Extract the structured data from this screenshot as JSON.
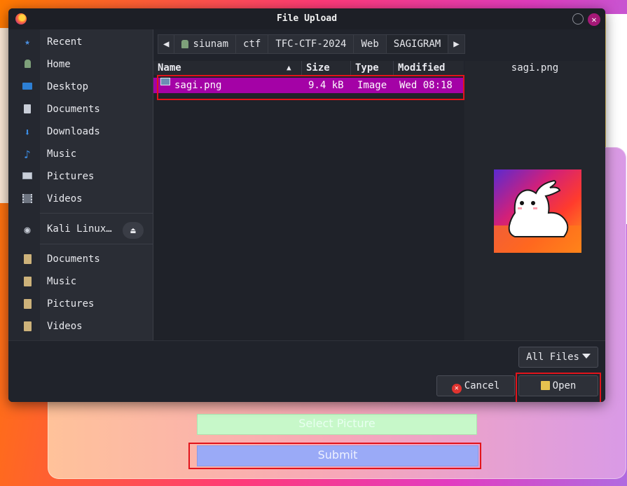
{
  "dialog": {
    "title": "File Upload",
    "close_glyph": "✕"
  },
  "sidebar": {
    "places": [
      {
        "label": "Recent",
        "icon": "clock-icon"
      },
      {
        "label": "Home",
        "icon": "home-icon"
      },
      {
        "label": "Desktop",
        "icon": "desktop-icon"
      },
      {
        "label": "Documents",
        "icon": "document-icon"
      },
      {
        "label": "Downloads",
        "icon": "download-icon"
      },
      {
        "label": "Music",
        "icon": "music-icon"
      },
      {
        "label": "Pictures",
        "icon": "picture-icon"
      },
      {
        "label": "Videos",
        "icon": "video-icon"
      }
    ],
    "device": {
      "label": "Kali Linux…",
      "icon": "disk-icon"
    },
    "bookmarks": [
      {
        "label": "Documents",
        "icon": "folder-icon"
      },
      {
        "label": "Music",
        "icon": "folder-icon"
      },
      {
        "label": "Pictures",
        "icon": "folder-icon"
      },
      {
        "label": "Videos",
        "icon": "folder-icon"
      }
    ]
  },
  "pathbar": {
    "crumbs": [
      "siunam",
      "ctf",
      "TFC-CTF-2024",
      "Web",
      "SAGIGRAM"
    ]
  },
  "filelist": {
    "columns": [
      "Name",
      "Size",
      "Type",
      "Modified"
    ],
    "rows": [
      {
        "name": "sagi.png",
        "size": "9.4 kB",
        "type": "Image",
        "modified": "Wed 08:18"
      }
    ]
  },
  "preview": {
    "filename": "sagi.png"
  },
  "footer": {
    "filter": "All Files",
    "cancel": "Cancel",
    "open": "Open"
  },
  "page": {
    "select_picture": "Select Picture",
    "submit": "Submit"
  },
  "colors": {
    "selection": "#a402a6",
    "highlight": "#e2141b"
  }
}
